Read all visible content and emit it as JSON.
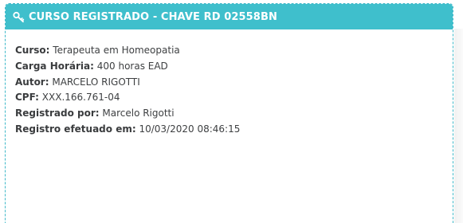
{
  "card": {
    "title": "CURSO REGISTRADO - CHAVE RD 02558BN",
    "icon": "key-icon",
    "header_color": "#3fbfcc",
    "fields": [
      {
        "label": "Curso:",
        "value": "Terapeuta em Homeopatia"
      },
      {
        "label": "Carga Horária:",
        "value": "400 horas EAD"
      },
      {
        "label": "Autor:",
        "value": "MARCELO RIGOTTI"
      },
      {
        "label": "CPF:",
        "value": "XXX.166.761-04"
      },
      {
        "label": "Registrado por:",
        "value": "Marcelo Rigotti"
      },
      {
        "label": "Registro efetuado em:",
        "value": "10/03/2020 08:46:15"
      }
    ]
  }
}
